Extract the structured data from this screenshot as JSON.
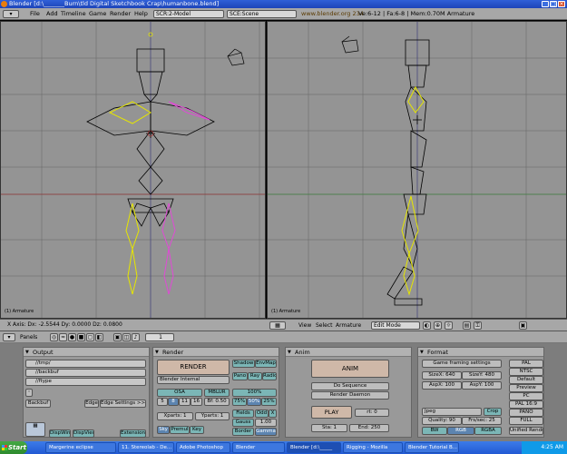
{
  "window": {
    "title": "Blender [d:\\_______Burn\\tld Digital Sketchbook Crap\\humanbone.blend]"
  },
  "menubar": {
    "items": [
      "File",
      "Add",
      "Timeline",
      "Game",
      "Render",
      "Help"
    ],
    "screen": "SCR:2-Model",
    "scene": "SCE:Scene",
    "website": "www.blender.org 234",
    "stats": "Ve:6-12 | Fa:6-8 | Mem:0.70M Armature"
  },
  "viewport_left": {
    "label": "(1) Armature"
  },
  "viewport_right": {
    "label": "(1) Armature"
  },
  "infostrip": {
    "text": "X Axis: Dx: -2.5544   Dy: 0.0000   Dz: 0.0800"
  },
  "vpheader": {
    "view": "View",
    "select": "Select",
    "armature": "Armature",
    "mode": "Edit Mode"
  },
  "buttons_header": {
    "panels": "Panels",
    "frame": "1"
  },
  "output": {
    "title": "Output",
    "paths": [
      "//tmp/",
      "//backbuf",
      "//ftype"
    ],
    "backbuf": "Backbuf",
    "edge": "Edge",
    "edge_settings": "Edge Settings >>",
    "dispwin": "DispWin",
    "dispview": "DispView",
    "extension": "Extension"
  },
  "render": {
    "title": "Render",
    "render_btn": "RENDER",
    "shadow": "Shadow",
    "envmap": "EnvMap",
    "engine": "Blender Internal",
    "pano": "Pano",
    "ray": "Ray",
    "radio": "Radio",
    "osa": "OSA",
    "mblur": "MBLUR",
    "osa_vals": [
      "5",
      "8",
      "11",
      "16"
    ],
    "bf": "Bf: 0.50",
    "percent": "100%",
    "percents": [
      "75%",
      "50%",
      "25%"
    ],
    "xparts": "Xparts: 1",
    "yparts": "Yparts: 1",
    "fields": "Fields",
    "odd": "Odd",
    "x": "X",
    "gauss": "Gauss",
    "gauss_val": "1.00",
    "sky": "Sky",
    "premul": "Premul",
    "key": "Key",
    "border": "Border",
    "gamma": "Gamma"
  },
  "anim": {
    "title": "Anim",
    "anim_btn": "ANIM",
    "do_sequence": "Do Sequence",
    "render_daemon": "Render Daemon",
    "play": "PLAY",
    "rt": "rt: 0",
    "sta": "Sta: 1",
    "end": "End: 250"
  },
  "format": {
    "title": "Format",
    "game_framing": "Game framing settings",
    "sizex": "SizeX: 640",
    "sizey": "SizeY: 480",
    "aspx": "AspX: 100",
    "aspy": "AspY: 100",
    "filetype": "Jpeg",
    "crop": "Crop",
    "quality": "Quality: 90",
    "fps": "Frs/sec: 25",
    "bw": "BW",
    "rgb": "RGB",
    "rgba": "RGBA",
    "presets": [
      "PAL",
      "NTSC",
      "Default",
      "Preview",
      "PC",
      "PAL 16:9",
      "PANO",
      "FULL",
      "Unified Rende"
    ]
  },
  "taskbar": {
    "start": "Start",
    "tasks": [
      "Margerine eclipse",
      "11. Stereolab - De...",
      "Adobe Photoshop",
      "Blender",
      "Blender [d:\\_____",
      "Rigging - Mozilla",
      "Blender Tutorial B..."
    ],
    "time": "4:25 AM"
  }
}
